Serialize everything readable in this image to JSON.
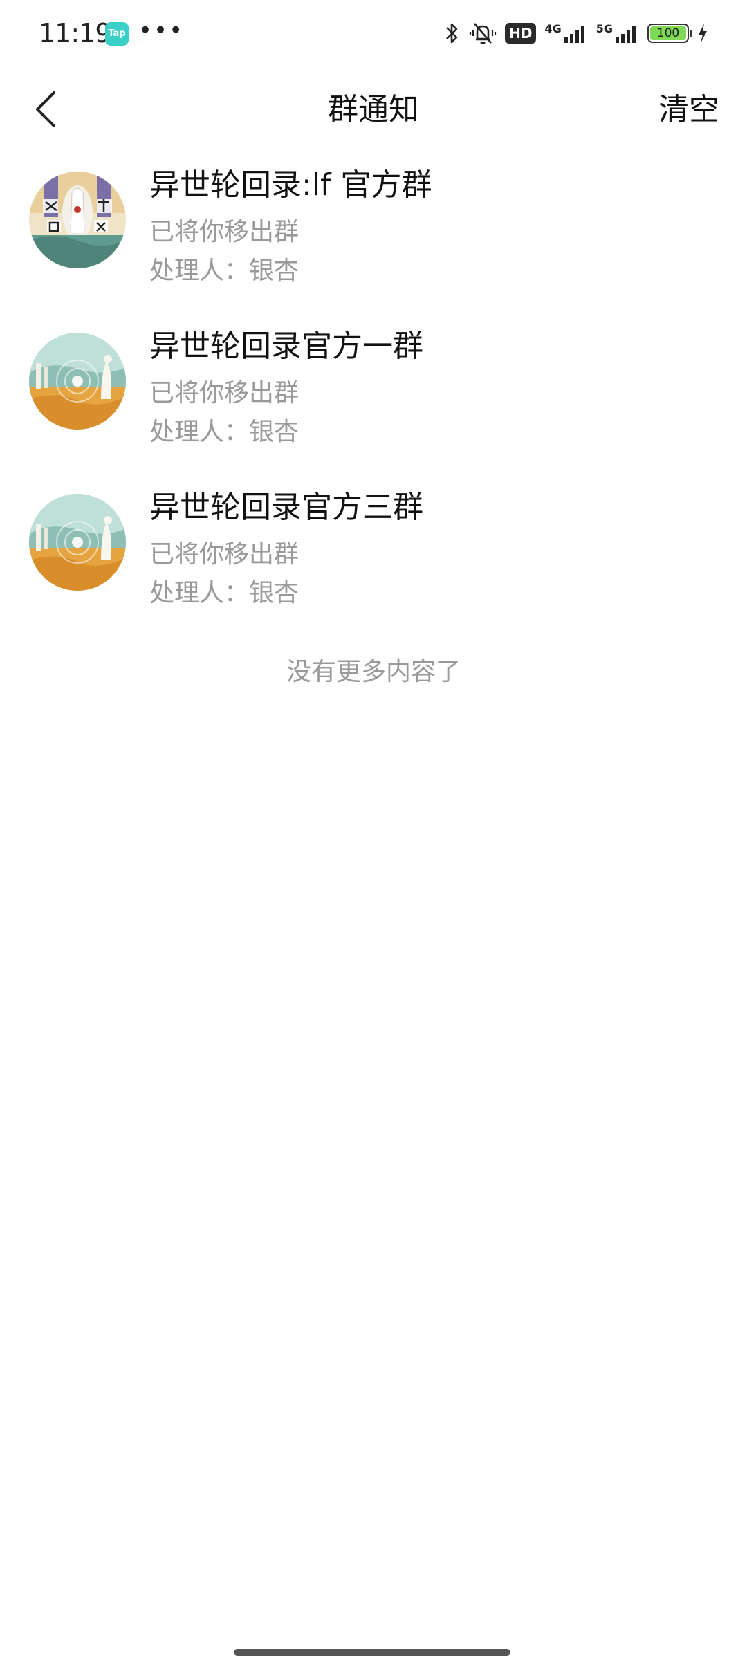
{
  "status_bar": {
    "time": "11:19",
    "app_badge": "Tap",
    "more_indicator": "•••",
    "hd_label": "HD",
    "net1_label": "4G",
    "net2_label": "5G",
    "battery_level": "100",
    "icons": [
      "bluetooth-icon",
      "mute-vibrate-icon",
      "hd-icon",
      "signal-4g-icon",
      "signal-5g-icon",
      "battery-icon",
      "charging-icon"
    ]
  },
  "header": {
    "back_icon": "chevron-left-icon",
    "title": "群通知",
    "clear_label": "清空"
  },
  "notices": [
    {
      "group_name": "异世轮回录:lf 官方群",
      "description": "已将你移出群",
      "handler": "处理人：银杏",
      "avatar": "group-avatar-art"
    },
    {
      "group_name": "异世轮回录官方一群",
      "description": "已将你移出群",
      "handler": "处理人：银杏",
      "avatar": "group-avatar-landscape"
    },
    {
      "group_name": "异世轮回录官方三群",
      "description": "已将你移出群",
      "handler": "处理人：银杏",
      "avatar": "group-avatar-landscape"
    }
  ],
  "footer": {
    "no_more_text": "没有更多内容了"
  },
  "colors": {
    "text_primary": "#111111",
    "text_secondary": "#999999",
    "background": "#ffffff",
    "battery_fill": "#7ed957",
    "tap_badge": "#3ad0c8"
  }
}
